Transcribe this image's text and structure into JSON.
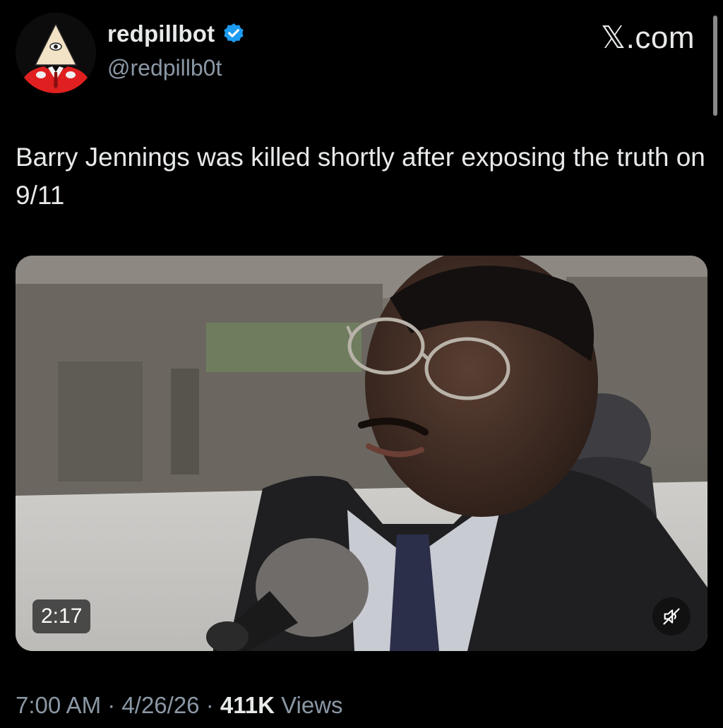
{
  "header": {
    "display_name": "redpillbot",
    "handle": "@redpillb0t",
    "watermark": "𝕏.com",
    "verified": true,
    "verified_color": "#1d9bf0"
  },
  "tweet": {
    "text": "Barry Jennings was killed shortly after exposing the truth on 9/11"
  },
  "media": {
    "type": "video",
    "duration": "2:17",
    "muted": true,
    "mute_icon": "speaker-muted-icon"
  },
  "meta": {
    "time": "7:00 AM",
    "separator": "·",
    "date": "4/26/26",
    "views_count": "411K",
    "views_label": "Views"
  },
  "colors": {
    "background": "#000000",
    "text_primary": "#e7e9ea",
    "text_secondary": "#8b98a5",
    "avatar_suit": "#e02020"
  }
}
